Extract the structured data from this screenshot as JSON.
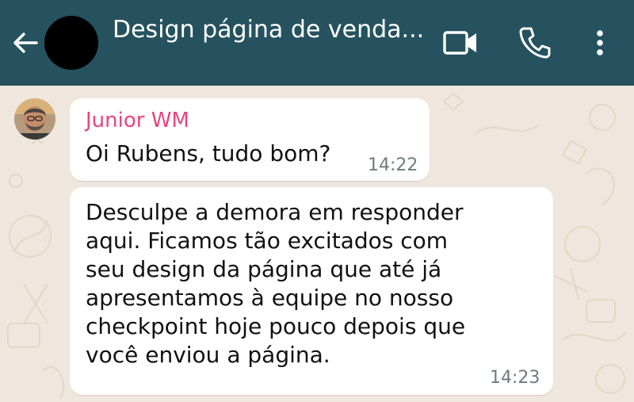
{
  "header": {
    "title": "Design página de venda...",
    "background_color": "#25525e",
    "icons": [
      "back-arrow-icon",
      "video-call-icon",
      "phone-call-icon",
      "more-options-icon"
    ]
  },
  "messages": [
    {
      "sender": "Junior WM",
      "sender_color": "#e8457c",
      "text": "Oi Rubens, tudo bom?",
      "time": "14:22"
    },
    {
      "lines": [
        "Desculpe a demora em responder",
        "aqui. Ficamos tão excitados com",
        "seu design da página que até já",
        "apresentamos à equipe no nosso",
        "checkpoint hoje pouco depois que",
        "você enviou a página."
      ],
      "time": "14:23"
    }
  ]
}
